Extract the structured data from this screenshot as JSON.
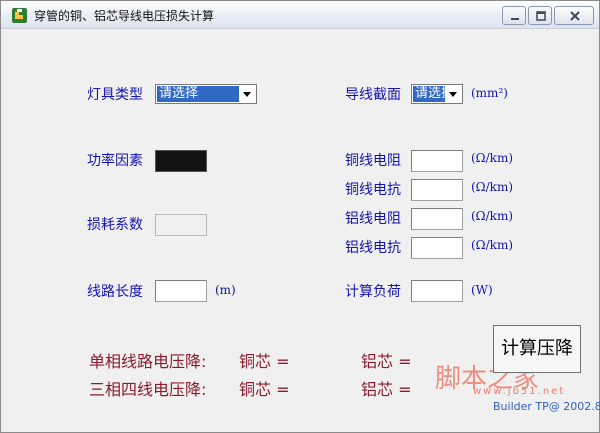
{
  "window": {
    "title": "穿管的铜、铝芯导线电压损失计算"
  },
  "fields": {
    "lamp_type": {
      "label": "灯具类型",
      "selected": "请选择"
    },
    "wire_section": {
      "label": "导线截面",
      "selected": "请选择",
      "unit": "(mm²)"
    },
    "power_factor": {
      "label": "功率因素"
    },
    "loss_coefficient": {
      "label": "损耗系数"
    },
    "line_length": {
      "label": "线路长度",
      "value": "",
      "unit": "(m)"
    },
    "calc_load": {
      "label": "计算负荷",
      "value": "",
      "unit": "(W)"
    },
    "cu_resistance": {
      "label": "铜线电阻",
      "value": "",
      "unit": "(Ω/km)"
    },
    "cu_reactance": {
      "label": "铜线电抗",
      "value": "",
      "unit": "(Ω/km)"
    },
    "al_resistance": {
      "label": "铝线电阻",
      "value": "",
      "unit": "(Ω/km)"
    },
    "al_reactance": {
      "label": "铝线电抗",
      "value": "",
      "unit": "(Ω/km)"
    }
  },
  "results": {
    "single_phase": {
      "label": "单相线路电压降:",
      "copper": "铜芯 =",
      "aluminum": "铝芯 ="
    },
    "three_phase": {
      "label": "三相四线电压降:",
      "copper": "铜芯 =",
      "aluminum": "铝芯 ="
    }
  },
  "buttons": {
    "calculate": "计算压降"
  },
  "watermark": {
    "text": "脚本之家",
    "url": "www.jb51.net"
  },
  "footer": "Builder TP@ 2002.8",
  "colors": {
    "label": "#1414b4",
    "result": "#8b1a2b",
    "selection": "#3169c6",
    "watermark": "#ec7d6e"
  }
}
